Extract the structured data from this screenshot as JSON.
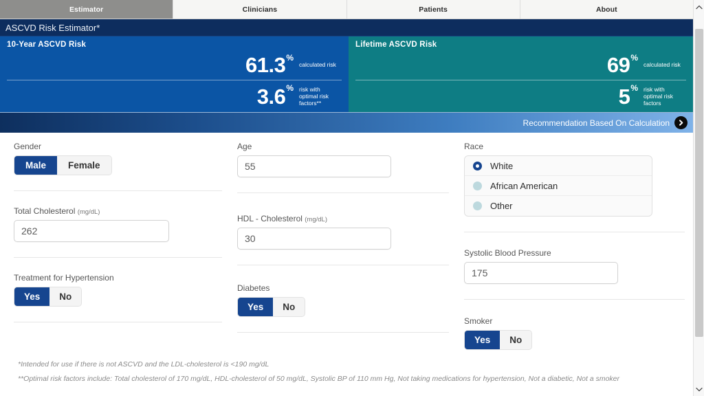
{
  "nav": {
    "tabs": [
      {
        "label": "Estimator",
        "active": true
      },
      {
        "label": "Clinicians",
        "active": false
      },
      {
        "label": "Patients",
        "active": false
      },
      {
        "label": "About",
        "active": false
      }
    ]
  },
  "app": {
    "title": "ASCVD Risk Estimator*"
  },
  "results": {
    "ten_year": {
      "title": "10-Year ASCVD Risk",
      "calculated_value": "61.3",
      "calculated_pct": "%",
      "calculated_label": "calculated risk",
      "optimal_value": "3.6",
      "optimal_pct": "%",
      "optimal_label": "risk with optimal risk factors**",
      "color": "#0b55a5"
    },
    "lifetime": {
      "title": "Lifetime ASCVD Risk",
      "calculated_value": "69",
      "calculated_pct": "%",
      "calculated_label": "calculated risk",
      "optimal_value": "5",
      "optimal_pct": "%",
      "optimal_label": "risk with optimal risk factors",
      "color": "#0e7d84"
    }
  },
  "recommendation": {
    "label": "Recommendation Based On Calculation",
    "icon": "chevron-right-icon"
  },
  "form": {
    "gender": {
      "label": "Gender",
      "options": [
        "Male",
        "Female"
      ],
      "selected": "Male"
    },
    "age": {
      "label": "Age",
      "value": "55",
      "placeholder": "Age"
    },
    "race": {
      "label": "Race",
      "options": [
        "White",
        "African American",
        "Other"
      ],
      "selected": "White"
    },
    "total_cholesterol": {
      "label": "Total Cholesterol",
      "unit": "(mg/dL)",
      "value": "262",
      "placeholder": "Total Cholesterol"
    },
    "hdl_cholesterol": {
      "label": "HDL - Cholesterol",
      "unit": "(mg/dL)",
      "value": "30",
      "placeholder": "HDL - Cholesterol"
    },
    "systolic_bp": {
      "label": "Systolic Blood Pressure",
      "value": "175",
      "placeholder": "Systolic Blood Pressure"
    },
    "hypertension_treatment": {
      "label": "Treatment for Hypertension",
      "options": [
        "Yes",
        "No"
      ],
      "selected": "Yes"
    },
    "diabetes": {
      "label": "Diabetes",
      "options": [
        "Yes",
        "No"
      ],
      "selected": "Yes"
    },
    "smoker": {
      "label": "Smoker",
      "options": [
        "Yes",
        "No"
      ],
      "selected": "Yes"
    }
  },
  "footnotes": {
    "line1": "*Intended for use if there is not ASCVD and the LDL-cholesterol is <190 mg/dL",
    "line2": "**Optimal risk factors include: Total cholesterol of 170 mg/dL, HDL-cholesterol of 50 mg/dL, Systolic BP of 110 mm Hg, Not taking medications for hypertension, Not a diabetic, Not a smoker"
  },
  "scrollbar": {
    "up_icon": "chevron-up-icon",
    "down_icon": "chevron-down-icon"
  }
}
